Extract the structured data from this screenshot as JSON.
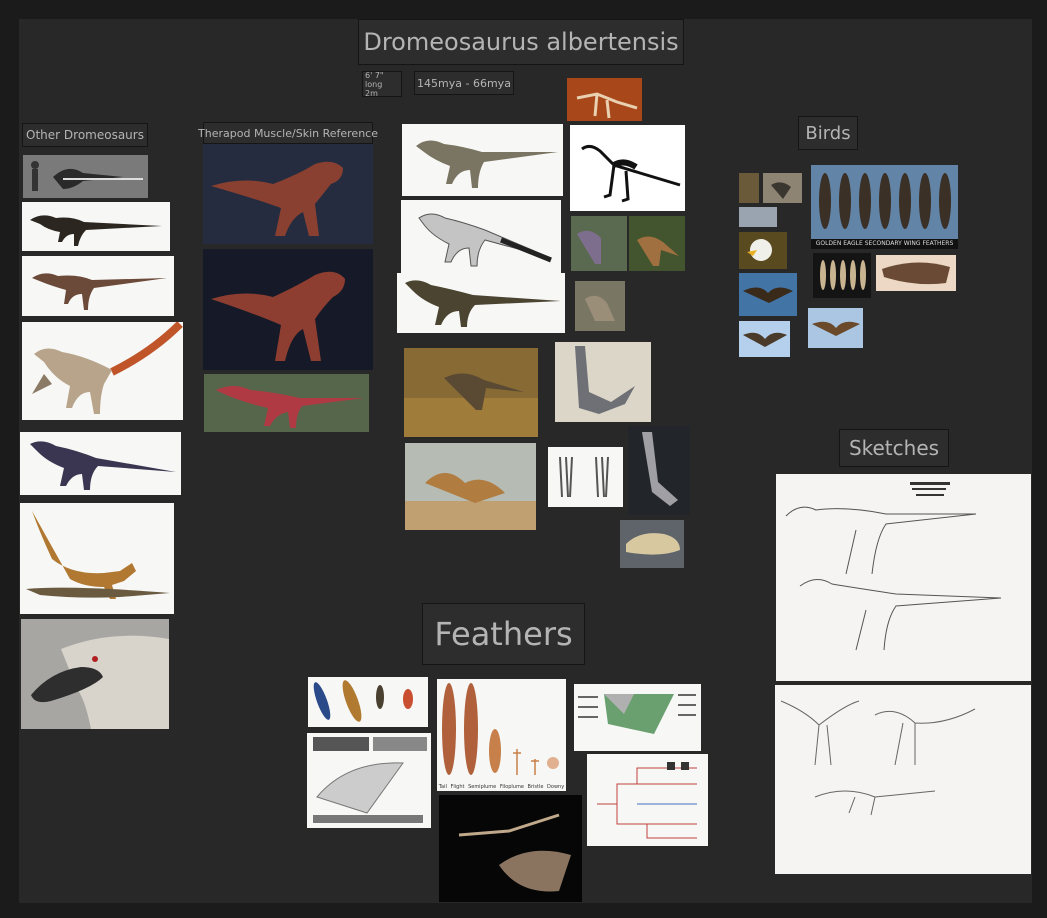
{
  "board": {
    "title": "Dromeosaurus albertensis",
    "size_line1": "6' 7\" long",
    "size_line2": "2m",
    "period": "145mya - 66mya",
    "sections": {
      "other": "Other Dromeosaurs",
      "therapod": "Therapod Muscle/Skin Reference",
      "birds": "Birds",
      "sketches": "Sketches",
      "feathers": "Feathers"
    },
    "image_caption_golden_eagle": "GOLDEN EAGLE SECONDARY WING FEATHERS",
    "feather_types": [
      "Tail",
      "Flight",
      "Semiplume",
      "Filoplume",
      "Bristle",
      "Downy"
    ]
  },
  "colors": {
    "page_bg": "#1b1b1b",
    "board_bg": "#282828",
    "label_bg": "#2d2d2d",
    "label_text": "#b4b4b4"
  }
}
